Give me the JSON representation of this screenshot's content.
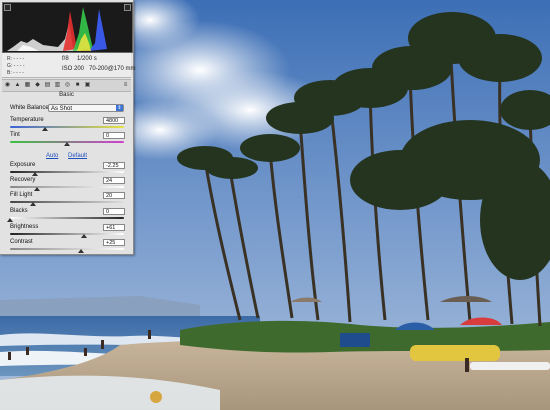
{
  "panel": {
    "histogram_clip_shadow_label": "",
    "readout": {
      "r": "R:  - - - -",
      "g": "G:  - - - -",
      "b": "B:  - - - -"
    },
    "exif": {
      "aperture": "f/8",
      "shutter": "1/200 s",
      "iso": "ISO 200",
      "lens": "70-200@170 mm"
    },
    "tools": [
      "aperture-icon",
      "mountain-icon",
      "curve-icon",
      "detail-icon",
      "hsl-icon",
      "split-icon",
      "lens-icon",
      "camera-icon",
      "presets-icon",
      "menu-icon"
    ],
    "section": "Basic",
    "white_balance": {
      "label": "White Balance:",
      "value": "As Shot"
    },
    "temperature": {
      "label": "Temperature",
      "value": "4800",
      "level": 0.31
    },
    "tint": {
      "label": "Tint",
      "value": "0",
      "level": 0.5
    },
    "auto_label": "Auto",
    "default_label": "Default",
    "exposure": {
      "label": "Exposure",
      "value": "-2.25",
      "level": 0.22
    },
    "recovery": {
      "label": "Recovery",
      "value": "24",
      "level": 0.24
    },
    "fill_light": {
      "label": "Fill Light",
      "value": "20",
      "level": 0.2
    },
    "blacks": {
      "label": "Blacks",
      "value": "0",
      "level": 0.0
    },
    "brightness": {
      "label": "Brightness",
      "value": "+61",
      "level": 0.65
    },
    "contrast": {
      "label": "Contrast",
      "value": "+25",
      "level": 0.62
    }
  }
}
